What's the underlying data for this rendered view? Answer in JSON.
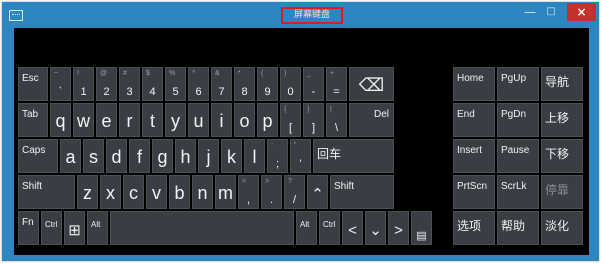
{
  "window": {
    "title": "屏幕键盘",
    "min": "—",
    "max": "□",
    "close": "×"
  },
  "keys": {
    "esc": "Esc",
    "tilde": {
      "top": "~",
      "main": "`"
    },
    "d1": {
      "top": "!",
      "main": "1"
    },
    "d2": {
      "top": "@",
      "main": "2"
    },
    "d3": {
      "top": "#",
      "main": "3"
    },
    "d4": {
      "top": "$",
      "main": "4"
    },
    "d5": {
      "top": "%",
      "main": "5"
    },
    "d6": {
      "top": "^",
      "main": "6"
    },
    "d7": {
      "top": "&",
      "main": "7"
    },
    "d8": {
      "top": "*",
      "main": "8"
    },
    "d9": {
      "top": "(",
      "main": "9"
    },
    "d0": {
      "top": ")",
      "main": "0"
    },
    "minus": {
      "top": "_",
      "main": "-"
    },
    "equals": {
      "top": "+",
      "main": "="
    },
    "backspace": "⌫",
    "home": "Home",
    "pgup": "PgUp",
    "nav": "导航",
    "tab": "Tab",
    "q": "q",
    "w": "w",
    "e": "e",
    "r": "r",
    "t": "t",
    "y": "y",
    "u": "u",
    "i": "i",
    "o": "o",
    "p": "p",
    "lbracket": {
      "top": "{",
      "main": "["
    },
    "rbracket": {
      "top": "}",
      "main": "]"
    },
    "backslash": {
      "top": "|",
      "main": "\\"
    },
    "del": "Del",
    "end": "End",
    "pgdn": "PgDn",
    "moveup": "上移",
    "caps": "Caps",
    "a": "a",
    "s": "s",
    "d": "d",
    "f": "f",
    "g": "g",
    "h": "h",
    "j": "j",
    "k": "k",
    "l": "l",
    "semicolon": {
      "top": ":",
      "main": ";"
    },
    "quote": {
      "top": "\"",
      "main": "'"
    },
    "enter": "回车",
    "insert": "Insert",
    "pause": "Pause",
    "movedown": "下移",
    "shift_l": "Shift",
    "z": "z",
    "x": "x",
    "c": "c",
    "v": "v",
    "b": "b",
    "n": "n",
    "m": "m",
    "comma": {
      "top": "<",
      "main": ","
    },
    "period": {
      "top": ">",
      "main": "."
    },
    "slash": {
      "top": "?",
      "main": "/"
    },
    "up": "⌃",
    "shift_r": "Shift",
    "prtscn": "PrtScn",
    "scrlk": "ScrLk",
    "dock": "停靠",
    "fn": "Fn",
    "ctrl_l": "Ctrl",
    "win": "⊞",
    "alt_l": "Alt",
    "alt_r": "Alt",
    "ctrl_r": "Ctrl",
    "left": "<",
    "down": "⌄",
    "right": ">",
    "menu": "▤",
    "options": "选项",
    "help": "帮助",
    "fade": "淡化"
  }
}
